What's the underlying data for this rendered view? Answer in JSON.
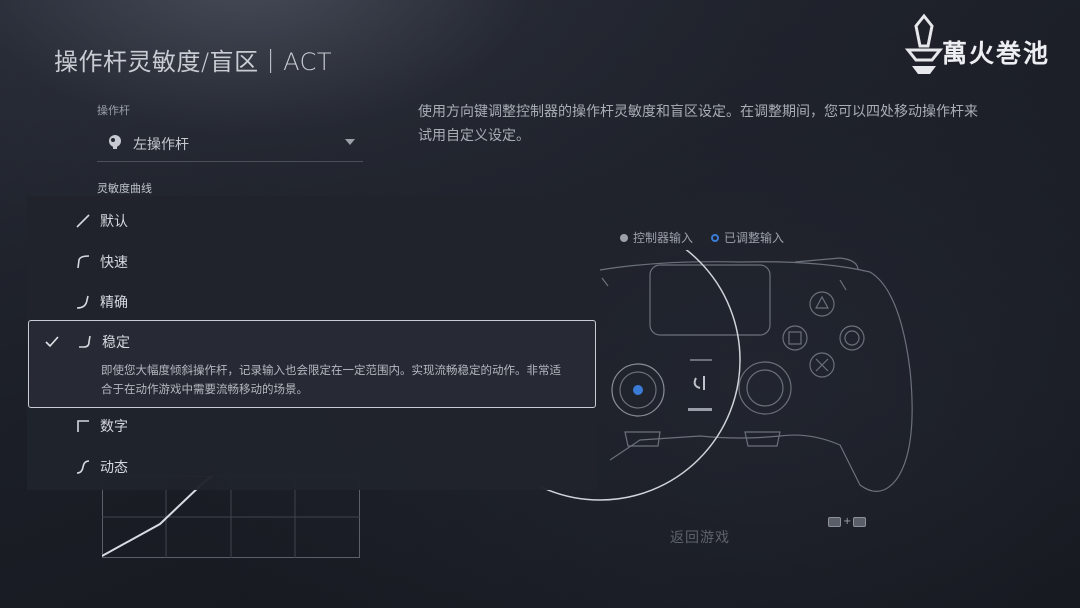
{
  "header": {
    "title": "操作杆灵敏度/盲区｜ACT"
  },
  "logo": {
    "text": "萬火巻池"
  },
  "stick": {
    "label": "操作杆",
    "value": "左操作杆"
  },
  "curve": {
    "label": "灵敏度曲线",
    "options": [
      {
        "label": "默认"
      },
      {
        "label": "快速"
      },
      {
        "label": "精确"
      },
      {
        "label": "稳定",
        "description": "即使您大幅度倾斜操作杆，记录输入也会限定在一定范围内。实现流畅稳定的动作。非常适合于在动作游戏中需要流畅移动的场景。"
      },
      {
        "label": "数字"
      },
      {
        "label": "动态"
      }
    ],
    "selected_index": 3
  },
  "description": "使用方向键调整控制器的操作杆灵敏度和盲区设定。在调整期间，您可以四处移动操作杆来试用自定义设定。",
  "legend": {
    "controller_input": "控制器输入",
    "adjusted_input": "已调整输入"
  },
  "footer": {
    "back_label": "返回游戏",
    "shortcut_plus": "+"
  },
  "colors": {
    "accent": "#3a7bd5",
    "selected_border": "#c9ccd3"
  }
}
